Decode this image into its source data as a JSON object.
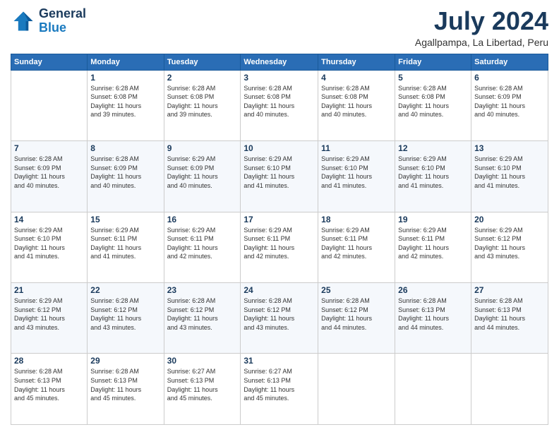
{
  "header": {
    "logo": {
      "general": "General",
      "blue": "Blue"
    },
    "title": "July 2024",
    "location": "Agallpampa, La Libertad, Peru"
  },
  "calendar": {
    "columns": [
      "Sunday",
      "Monday",
      "Tuesday",
      "Wednesday",
      "Thursday",
      "Friday",
      "Saturday"
    ],
    "weeks": [
      [
        {
          "day": "",
          "sunrise": "",
          "sunset": "",
          "daylight": ""
        },
        {
          "day": "1",
          "sunrise": "Sunrise: 6:28 AM",
          "sunset": "Sunset: 6:08 PM",
          "daylight": "Daylight: 11 hours and 39 minutes."
        },
        {
          "day": "2",
          "sunrise": "Sunrise: 6:28 AM",
          "sunset": "Sunset: 6:08 PM",
          "daylight": "Daylight: 11 hours and 39 minutes."
        },
        {
          "day": "3",
          "sunrise": "Sunrise: 6:28 AM",
          "sunset": "Sunset: 6:08 PM",
          "daylight": "Daylight: 11 hours and 40 minutes."
        },
        {
          "day": "4",
          "sunrise": "Sunrise: 6:28 AM",
          "sunset": "Sunset: 6:08 PM",
          "daylight": "Daylight: 11 hours and 40 minutes."
        },
        {
          "day": "5",
          "sunrise": "Sunrise: 6:28 AM",
          "sunset": "Sunset: 6:08 PM",
          "daylight": "Daylight: 11 hours and 40 minutes."
        },
        {
          "day": "6",
          "sunrise": "Sunrise: 6:28 AM",
          "sunset": "Sunset: 6:09 PM",
          "daylight": "Daylight: 11 hours and 40 minutes."
        }
      ],
      [
        {
          "day": "7",
          "sunrise": "Sunrise: 6:28 AM",
          "sunset": "Sunset: 6:09 PM",
          "daylight": "Daylight: 11 hours and 40 minutes."
        },
        {
          "day": "8",
          "sunrise": "Sunrise: 6:28 AM",
          "sunset": "Sunset: 6:09 PM",
          "daylight": "Daylight: 11 hours and 40 minutes."
        },
        {
          "day": "9",
          "sunrise": "Sunrise: 6:29 AM",
          "sunset": "Sunset: 6:09 PM",
          "daylight": "Daylight: 11 hours and 40 minutes."
        },
        {
          "day": "10",
          "sunrise": "Sunrise: 6:29 AM",
          "sunset": "Sunset: 6:10 PM",
          "daylight": "Daylight: 11 hours and 41 minutes."
        },
        {
          "day": "11",
          "sunrise": "Sunrise: 6:29 AM",
          "sunset": "Sunset: 6:10 PM",
          "daylight": "Daylight: 11 hours and 41 minutes."
        },
        {
          "day": "12",
          "sunrise": "Sunrise: 6:29 AM",
          "sunset": "Sunset: 6:10 PM",
          "daylight": "Daylight: 11 hours and 41 minutes."
        },
        {
          "day": "13",
          "sunrise": "Sunrise: 6:29 AM",
          "sunset": "Sunset: 6:10 PM",
          "daylight": "Daylight: 11 hours and 41 minutes."
        }
      ],
      [
        {
          "day": "14",
          "sunrise": "Sunrise: 6:29 AM",
          "sunset": "Sunset: 6:10 PM",
          "daylight": "Daylight: 11 hours and 41 minutes."
        },
        {
          "day": "15",
          "sunrise": "Sunrise: 6:29 AM",
          "sunset": "Sunset: 6:11 PM",
          "daylight": "Daylight: 11 hours and 41 minutes."
        },
        {
          "day": "16",
          "sunrise": "Sunrise: 6:29 AM",
          "sunset": "Sunset: 6:11 PM",
          "daylight": "Daylight: 11 hours and 42 minutes."
        },
        {
          "day": "17",
          "sunrise": "Sunrise: 6:29 AM",
          "sunset": "Sunset: 6:11 PM",
          "daylight": "Daylight: 11 hours and 42 minutes."
        },
        {
          "day": "18",
          "sunrise": "Sunrise: 6:29 AM",
          "sunset": "Sunset: 6:11 PM",
          "daylight": "Daylight: 11 hours and 42 minutes."
        },
        {
          "day": "19",
          "sunrise": "Sunrise: 6:29 AM",
          "sunset": "Sunset: 6:11 PM",
          "daylight": "Daylight: 11 hours and 42 minutes."
        },
        {
          "day": "20",
          "sunrise": "Sunrise: 6:29 AM",
          "sunset": "Sunset: 6:12 PM",
          "daylight": "Daylight: 11 hours and 43 minutes."
        }
      ],
      [
        {
          "day": "21",
          "sunrise": "Sunrise: 6:29 AM",
          "sunset": "Sunset: 6:12 PM",
          "daylight": "Daylight: 11 hours and 43 minutes."
        },
        {
          "day": "22",
          "sunrise": "Sunrise: 6:28 AM",
          "sunset": "Sunset: 6:12 PM",
          "daylight": "Daylight: 11 hours and 43 minutes."
        },
        {
          "day": "23",
          "sunrise": "Sunrise: 6:28 AM",
          "sunset": "Sunset: 6:12 PM",
          "daylight": "Daylight: 11 hours and 43 minutes."
        },
        {
          "day": "24",
          "sunrise": "Sunrise: 6:28 AM",
          "sunset": "Sunset: 6:12 PM",
          "daylight": "Daylight: 11 hours and 43 minutes."
        },
        {
          "day": "25",
          "sunrise": "Sunrise: 6:28 AM",
          "sunset": "Sunset: 6:12 PM",
          "daylight": "Daylight: 11 hours and 44 minutes."
        },
        {
          "day": "26",
          "sunrise": "Sunrise: 6:28 AM",
          "sunset": "Sunset: 6:13 PM",
          "daylight": "Daylight: 11 hours and 44 minutes."
        },
        {
          "day": "27",
          "sunrise": "Sunrise: 6:28 AM",
          "sunset": "Sunset: 6:13 PM",
          "daylight": "Daylight: 11 hours and 44 minutes."
        }
      ],
      [
        {
          "day": "28",
          "sunrise": "Sunrise: 6:28 AM",
          "sunset": "Sunset: 6:13 PM",
          "daylight": "Daylight: 11 hours and 45 minutes."
        },
        {
          "day": "29",
          "sunrise": "Sunrise: 6:28 AM",
          "sunset": "Sunset: 6:13 PM",
          "daylight": "Daylight: 11 hours and 45 minutes."
        },
        {
          "day": "30",
          "sunrise": "Sunrise: 6:27 AM",
          "sunset": "Sunset: 6:13 PM",
          "daylight": "Daylight: 11 hours and 45 minutes."
        },
        {
          "day": "31",
          "sunrise": "Sunrise: 6:27 AM",
          "sunset": "Sunset: 6:13 PM",
          "daylight": "Daylight: 11 hours and 45 minutes."
        },
        {
          "day": "",
          "sunrise": "",
          "sunset": "",
          "daylight": ""
        },
        {
          "day": "",
          "sunrise": "",
          "sunset": "",
          "daylight": ""
        },
        {
          "day": "",
          "sunrise": "",
          "sunset": "",
          "daylight": ""
        }
      ]
    ]
  }
}
